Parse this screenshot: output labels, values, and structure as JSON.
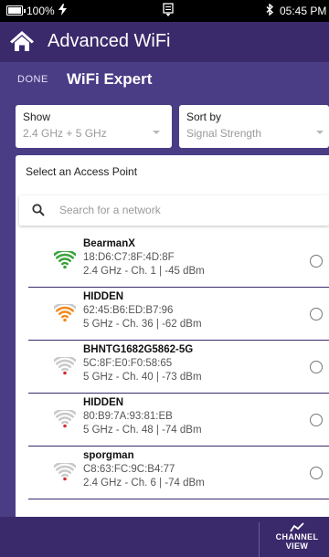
{
  "statusbar": {
    "battery_pct": "100%",
    "battery_level": 1.0,
    "time": "05:45 PM"
  },
  "appbar": {
    "title": "Advanced WiFi"
  },
  "subbar": {
    "done_label": "DONE",
    "title": "WiFi Expert"
  },
  "filters": {
    "show": {
      "label": "Show",
      "value": "2.4 GHz + 5 GHz"
    },
    "sort": {
      "label": "Sort by",
      "value": "Signal Strength"
    }
  },
  "panel": {
    "heading": "Select an Access Point",
    "search_placeholder": "Search for a network",
    "access_points": [
      {
        "name": "BearmanX",
        "mac": "18:D6:C7:8F:4D:8F",
        "info": "2.4 GHz - Ch. 1 | -45 dBm",
        "signal_color": "#3aa33a",
        "signal_bars": 4
      },
      {
        "name": "HIDDEN",
        "mac": "62:45:B6:ED:B7:96",
        "info": "5 GHz - Ch. 36 | -62 dBm",
        "signal_color": "#f08a1c",
        "signal_bars": 3
      },
      {
        "name": "BHNTG1682G5862-5G",
        "mac": "5C:8F:E0:F0:58:65",
        "info": "5 GHz - Ch. 40 | -73 dBm",
        "signal_color": "#d32f2f",
        "signal_bars": 1
      },
      {
        "name": "HIDDEN",
        "mac": "80:B9:7A:93:81:EB",
        "info": "5 GHz - Ch. 48 | -74 dBm",
        "signal_color": "#d32f2f",
        "signal_bars": 1
      },
      {
        "name": "sporgman",
        "mac": "C8:63:FC:9C:B4:77",
        "info": "2.4 GHz - Ch. 6 | -74 dBm",
        "signal_color": "#d32f2f",
        "signal_bars": 1
      }
    ]
  },
  "bottombar": {
    "channel_view_label": "CHANNEL\nVIEW"
  },
  "colors": {
    "appbar": "#3a2a6b",
    "subbar": "#4a3d86",
    "background": "#2c1f54"
  }
}
